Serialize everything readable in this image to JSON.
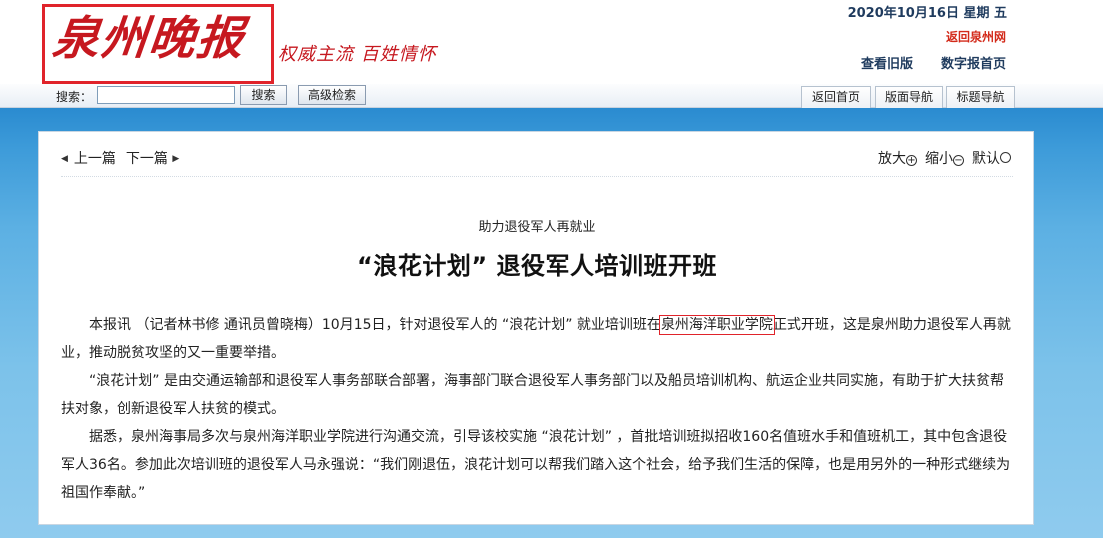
{
  "masthead": {
    "logo_text": "泉州晚报",
    "slogan": "权威主流  百姓情怀",
    "date": "2020年10月16日 星期 五",
    "back_site_link": "返回泉州网",
    "old_paper_link": "查看旧版",
    "digital_home_link": "数字报首页"
  },
  "search": {
    "label": "搜索：",
    "value": "",
    "search_button": "搜索",
    "advanced_button": "高级检索"
  },
  "nav": {
    "tabs": [
      "返回首页",
      "版面导航",
      "标题导航"
    ]
  },
  "article_nav": {
    "prev": "上一篇",
    "next": "下一篇",
    "zoom_in": "放大",
    "zoom_out": "缩小",
    "reset": "默认"
  },
  "article": {
    "kicker": "助力退役军人再就业",
    "title": "“浪花计划” 退役军人培训班开班",
    "p1_before": "本报讯 （记者林书修 通讯员曾晓梅）10月15日，针对退役军人的 “浪花计划” 就业培训班在",
    "p1_highlight": "泉州海洋职业学院",
    "p1_after": "正式开班，这是泉州助力退役军人再就业，推动脱贫攻坚的又一重要举措。",
    "p2": "“浪花计划” 是由交通运输部和退役军人事务部联合部署，海事部门联合退役军人事务部门以及船员培训机构、航运企业共同实施，有助于扩大扶贫帮扶对象，创新退役军人扶贫的模式。",
    "p3": "据悉，泉州海事局多次与泉州海洋职业学院进行沟通交流，引导该校实施 “浪花计划” ，首批培训班拟招收160名值班水手和值班机工，其中包含退役军人36名。参加此次培训班的退役军人马永强说：“我们刚退伍，浪花计划可以帮我们踏入这个社会，给予我们生活的保障，也是用另外的一种形式继续为祖国作奉献。”"
  },
  "colors": {
    "brand_red": "#c6181f",
    "highlight_border": "#e0232a",
    "background_blue": "#3d9bd9",
    "link_red": "#d32a1a",
    "nav_text": "#1f3b5e"
  }
}
